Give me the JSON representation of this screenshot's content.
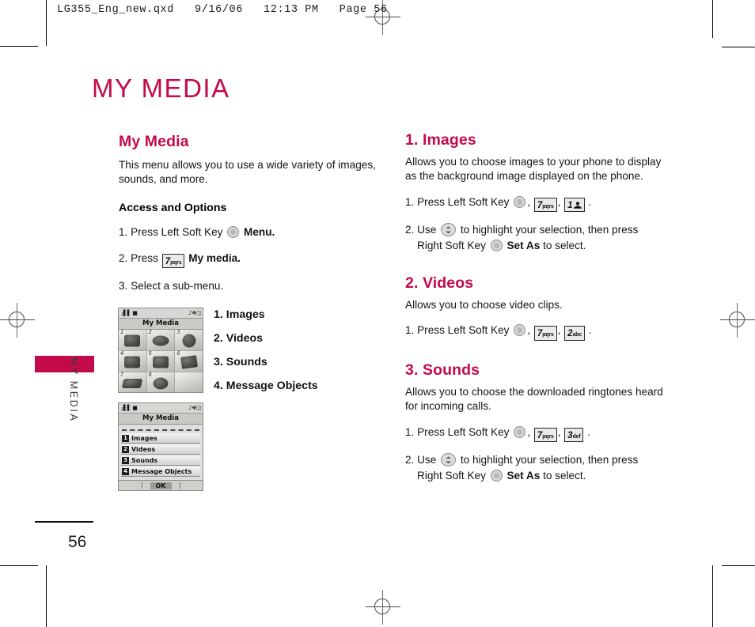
{
  "prepress": {
    "slug": "LG355_Eng_new.qxd   9/16/06   12:13 PM   Page 56"
  },
  "sidebar": {
    "chapter_vertical": "MY MEDIA",
    "page_number": "56",
    "tab_color": "#c40a4a"
  },
  "chapter": {
    "title": "MY MEDIA",
    "color": "#c40a4a"
  },
  "left_column": {
    "section_title": "My Media",
    "intro": "This menu allows you to use a wide variety of images, sounds, and more.",
    "subhead": "Access and Options",
    "steps": {
      "s1_pre": "1. Press Left Soft Key",
      "s1_post": "Menu.",
      "s2_pre": "2. Press",
      "s2_post": "My media.",
      "s3": "3. Select a sub-menu."
    },
    "submenu": [
      "1. Images",
      "2. Videos",
      "3. Sounds",
      "4. Message Objects"
    ]
  },
  "phone_grid": {
    "title": "My Media",
    "status_left": "signal-icon 1x-icon",
    "status_right": "music-icon bluetooth-icon battery-icon",
    "cells": [
      "1",
      "2",
      "3",
      "4",
      "5",
      "6",
      "7",
      "8"
    ]
  },
  "phone_list": {
    "title": "My Media",
    "status_left": "signal-icon 1x-icon",
    "status_right": "music-icon bluetooth-icon battery-icon",
    "rows": [
      {
        "num": "1",
        "label": "Images"
      },
      {
        "num": "2",
        "label": "Videos"
      },
      {
        "num": "3",
        "label": "Sounds"
      },
      {
        "num": "4",
        "label": "Message Objects"
      }
    ],
    "soft_ok": "OK"
  },
  "keys": {
    "seven": {
      "digit": "7",
      "letters": "pqrs"
    },
    "one": {
      "digit": "1",
      "letters": ""
    },
    "two": {
      "digit": "2",
      "letters": "abc"
    },
    "three": {
      "digit": "3",
      "letters": "def"
    }
  },
  "right_column": {
    "images": {
      "heading": "1. Images",
      "body": "Allows you to choose images to your phone to display as the background image displayed on the phone.",
      "step1_pre": "1. Press Left Soft Key",
      "step1_mid": ",",
      "step1_end": ".",
      "step2_pre": "2. Use",
      "step2_mid": "to highlight your selection, then press",
      "step2_cont_pre": "Right Soft Key",
      "step2_bold": "Set As",
      "step2_cont_post": "to select."
    },
    "videos": {
      "heading": "2. Videos",
      "body": "Allows you to choose video clips.",
      "step1_pre": "1. Press Left Soft Key",
      "step1_end": "."
    },
    "sounds": {
      "heading": "3. Sounds",
      "body": "Allows you to choose the downloaded ringtones heard for incoming calls.",
      "step1_pre": "1. Press Left Soft Key",
      "step1_end": ".",
      "step2_pre": "2. Use",
      "step2_mid": "to highlight your selection, then press",
      "step2_cont_pre": "Right Soft Key",
      "step2_bold": "Set As",
      "step2_cont_post": "to select."
    }
  }
}
